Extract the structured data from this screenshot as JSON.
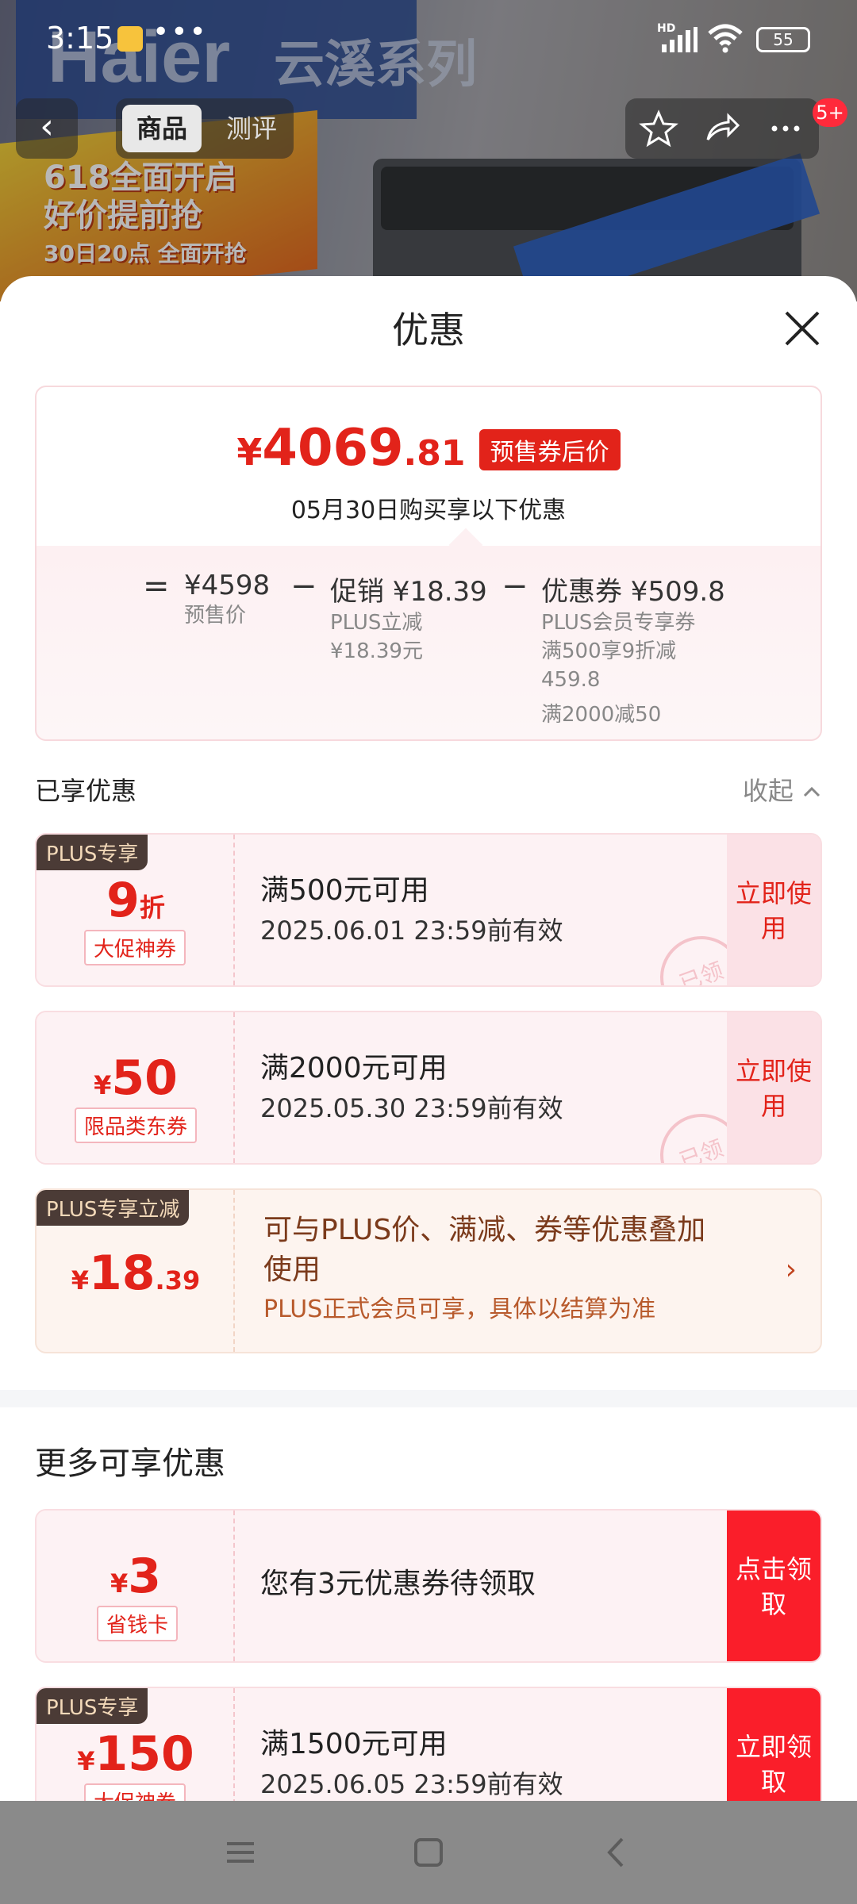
{
  "status_bar": {
    "time": "3:15",
    "network": "HD",
    "battery": "55"
  },
  "background": {
    "brand_logo": "Haier",
    "series": "云溪系列",
    "promo_line1": "618全面开启",
    "promo_line2": "好价提前抢",
    "promo_line3": "30日20点 全面开抢"
  },
  "top_nav": {
    "back_icon": "back-arrow-icon",
    "tabs": [
      "商品",
      "测评"
    ],
    "cart_badge": "5+"
  },
  "sheet": {
    "title": "优惠"
  },
  "summary": {
    "price_yen": "¥",
    "price_int": "4069",
    "price_dec": ".81",
    "price_tag": "预售券后价",
    "subtitle": "05月30日购买享以下优惠",
    "eq": "=",
    "presale_value": "¥4598",
    "presale_label": "预售价",
    "minus1": "−",
    "promo_value": "促销 ¥18.39",
    "promo_label1": "PLUS立减",
    "promo_label2": "¥18.39元",
    "minus2": "−",
    "coupon_value": "优惠券 ¥509.8",
    "coupon_label1": "PLUS会员专享券",
    "coupon_label2": "满500享9折减",
    "coupon_label3": "459.8",
    "coupon_label4": "满2000减50"
  },
  "enjoyed": {
    "heading": "已享优惠",
    "collapse": "收起"
  },
  "coupons": [
    {
      "tag": "PLUS专享",
      "value": "9",
      "unit": "折",
      "sub": "大促神券",
      "condition": "满500元可用",
      "date": "2025.06.01 23:59前有效",
      "action": "立即使用",
      "stamp": "已领"
    },
    {
      "tag": "",
      "yen": "¥",
      "value": "50",
      "sub": "限品类东券",
      "condition": "满2000元可用",
      "date": "2025.05.30 23:59前有效",
      "action": "立即使用",
      "stamp": "已领"
    }
  ],
  "plus_discount": {
    "tag": "PLUS专享立减",
    "yen": "¥",
    "value": "18",
    "dec": ".39",
    "line1": "可与PLUS价、满减、券等优惠叠加",
    "line2": "使用",
    "note": "PLUS正式会员可享，具体以结算为准",
    "arrow": "›"
  },
  "more": {
    "heading": "更多可享优惠"
  },
  "more_coupons": [
    {
      "yen": "¥",
      "value": "3",
      "sub": "省钱卡",
      "text": "您有3元优惠券待领取",
      "action": "点击领取"
    },
    {
      "tag": "PLUS专享",
      "yen": "¥",
      "value": "150",
      "sub": "大促神券",
      "condition": "满1500元可用",
      "date": "2025.06.05 23:59前有效",
      "action": "立即领取"
    }
  ],
  "colors": {
    "accent": "#e2231a",
    "button_red": "#fa1e2a",
    "plus_tag_bg": "#4b3b36"
  }
}
